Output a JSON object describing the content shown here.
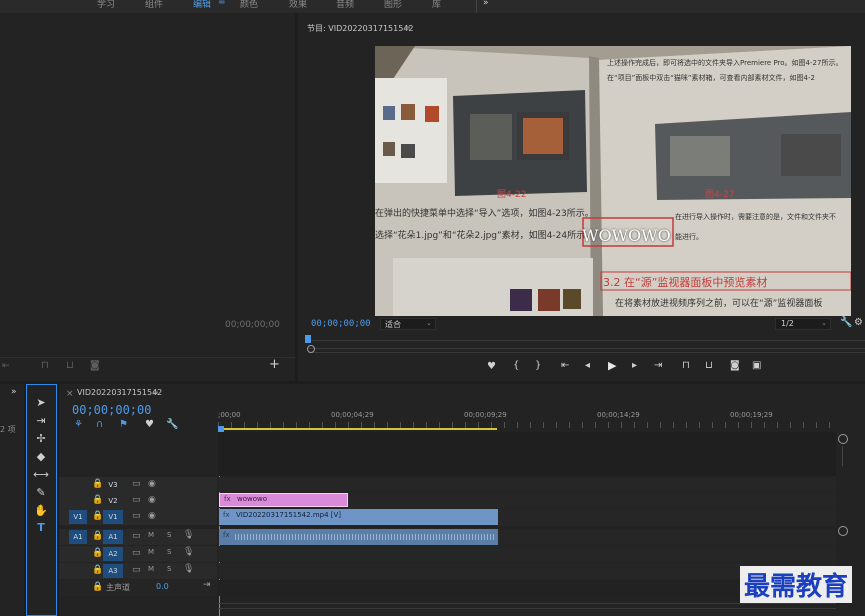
{
  "workspace_tabs": [
    "学习",
    "组件",
    "编辑",
    "颜色",
    "效果",
    "音频",
    "图形",
    "库"
  ],
  "workspace_active": "编辑",
  "workspace_overflow": "»",
  "source_panel": {
    "timecode": "00;00;00;00"
  },
  "program_panel": {
    "title": "节目: VID20220317151542",
    "timecode": "00;00;00;00",
    "fit_label": "适合",
    "resolution": "1/2",
    "overlay_title": "WOWOWO",
    "book": {
      "fig1": "图4-22",
      "fig2": "图4-27",
      "left_line1": "在弹出的快捷菜单中选择“导入”选项，如图4-23所示。",
      "left_line2": "选择“花朵1.jpg”和“花朵2.jpg”素材，如图4-24所示。",
      "right_line1": "上述操作完成后，即可将选中的文件夹导入Premiere Pro。如图4-27所示。",
      "right_line2": "在“项目”面板中双击“猫咪”素材箱，可查看内部素材文件，如图4-2",
      "right_line3": "在进行导入操作时，需要注意的是，文件和文件夹不",
      "right_line4": "能进行。",
      "heading": "3.2  在“源”监视器面板中预览素材",
      "bottom_line": "在将素材放进视频序列之前，可以在“源”监视器面板"
    }
  },
  "project_panel": {
    "count": "2 项"
  },
  "timeline": {
    "sequence_name": "VID20220317151542",
    "timecode": "00;00;00;00",
    "ruler": [
      ";00;00",
      "00;00;04;29",
      "00;00;09;29",
      "00;00;14;29",
      "00;00;19;29"
    ],
    "tracks": {
      "v3": "V3",
      "v2": "V2",
      "v1": "V1",
      "a1": "A1",
      "a2": "A2",
      "a3": "A3",
      "v1_src": "V1",
      "a1_src": "A1",
      "mute": "M",
      "solo": "S"
    },
    "master_label": "主声道",
    "master_value": "0.0",
    "clips": {
      "title_clip": "wowowo",
      "video_clip": "VID20220317151542.mp4 [V]"
    }
  },
  "watermark": "最需教育",
  "colors": {
    "accent": "#4d9be8",
    "title_clip": "#d98bd9",
    "video_clip": "#6f95c6",
    "audio_clip": "#5a7ea8"
  }
}
